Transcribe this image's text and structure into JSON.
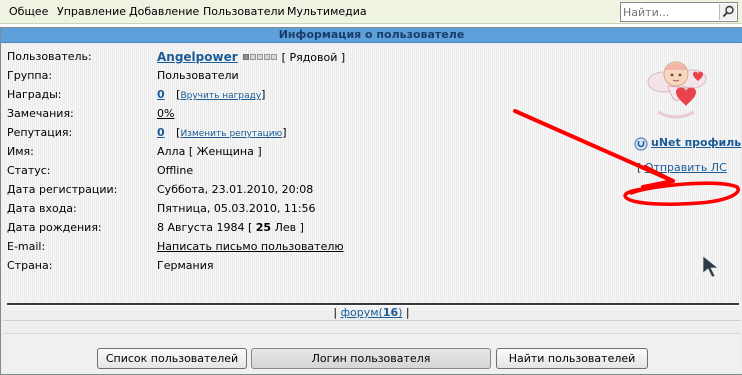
{
  "nav": {
    "items": [
      "Общее",
      "Управление",
      "Добавление",
      "Пользователи",
      "Мультимедиа"
    ],
    "search_placeholder": "Найти..."
  },
  "panel": {
    "title": "Информация о пользователе"
  },
  "profile": {
    "rows": [
      {
        "label": "Пользователь:",
        "value": "Angelpower",
        "suffix": "[ Рядовой ]"
      },
      {
        "label": "Группа:",
        "value": "Пользователи"
      },
      {
        "label": "Награды:",
        "value": "0",
        "action": "Вручить награду"
      },
      {
        "label": "Замечания:",
        "value": "0%"
      },
      {
        "label": "Репутация:",
        "value": "0",
        "action": "Изменить репутацию"
      },
      {
        "label": "Имя:",
        "value": "Алла",
        "suffix": "[ Женщина ]"
      },
      {
        "label": "Статус:",
        "value": "Offline"
      },
      {
        "label": "Дата регистрации:",
        "value": "Суббота, 23.01.2010, 20:08"
      },
      {
        "label": "Дата входа:",
        "value": "Пятница, 05.03.2010, 11:56"
      },
      {
        "label": "Дата рождения:",
        "value": "8 Августа 1984",
        "age": "25",
        "zodiac": "Лев"
      },
      {
        "label": "E-mail:",
        "value": "Написать письмо пользователю"
      },
      {
        "label": "Страна:",
        "value": "Германия"
      }
    ],
    "rank_level": 1,
    "rank_max": 5,
    "unet_label": "uNet профиль",
    "pm_label": "Отправить ЛС"
  },
  "forum": {
    "label": "форум",
    "count": "16"
  },
  "buttons": {
    "users_list": "Список пользователей",
    "user_login": "Логин пользователя",
    "find_users": "Найти пользователей"
  },
  "colors": {
    "titlebar": "#5ea0dc",
    "link": "#1b5c97",
    "offline": "#e06060",
    "annotation": "#ff0000"
  }
}
